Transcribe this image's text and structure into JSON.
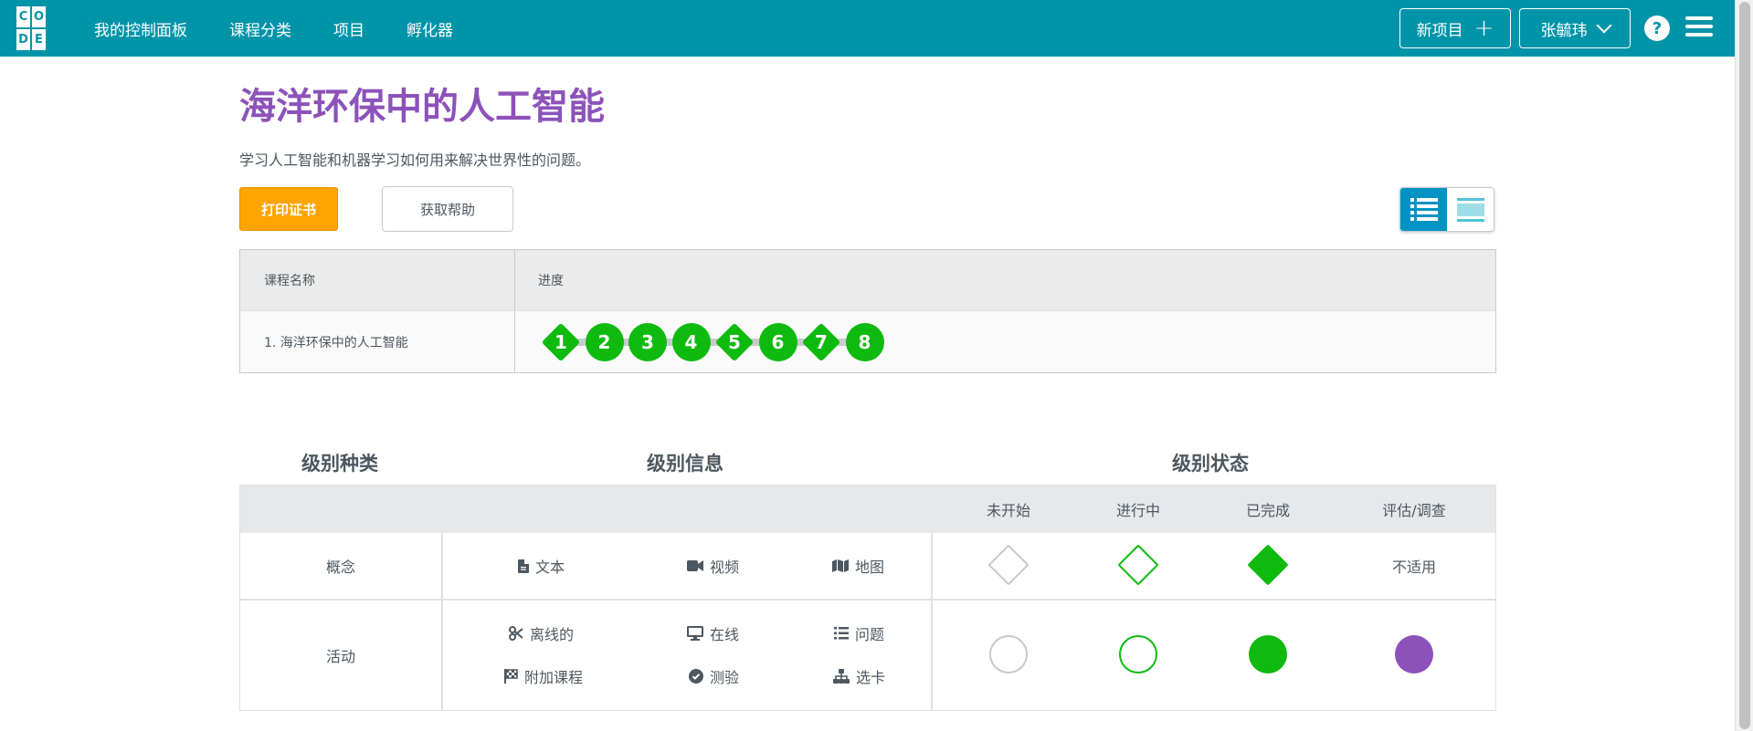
{
  "nav": {
    "logo_letters": [
      "C",
      "O",
      "",
      "D",
      "E",
      ""
    ],
    "items": [
      "我的控制面板",
      "课程分类",
      "项目",
      "孵化器"
    ],
    "new_project": "新项目",
    "user_name": "张毓玮",
    "help": "?"
  },
  "course": {
    "title": "海洋环保中的人工智能",
    "description": "学习人工智能和机器学习如何用来解决世界性的问题。",
    "print_button": "打印证书",
    "help_button": "获取帮助"
  },
  "progress_table": {
    "col_lesson": "课程名称",
    "col_progress": "进度",
    "rows": [
      {
        "lesson": "1. 海洋环保中的人工智能",
        "levels": [
          {
            "n": "1",
            "shape": "diamond",
            "status": "completed"
          },
          {
            "n": "2",
            "shape": "circle",
            "status": "completed"
          },
          {
            "n": "3",
            "shape": "circle",
            "status": "completed"
          },
          {
            "n": "4",
            "shape": "circle",
            "status": "completed"
          },
          {
            "n": "5",
            "shape": "diamond",
            "status": "completed"
          },
          {
            "n": "6",
            "shape": "circle",
            "status": "completed"
          },
          {
            "n": "7",
            "shape": "diamond",
            "status": "completed"
          },
          {
            "n": "8",
            "shape": "circle",
            "status": "completed"
          }
        ]
      }
    ]
  },
  "key": {
    "type_heading": "级别种类",
    "info_heading": "级别信息",
    "status_heading": "级别状态",
    "status_cols": [
      "未开始",
      "进行中",
      "已完成",
      "评估/调查"
    ],
    "concept": {
      "label": "概念",
      "items": [
        {
          "icon": "document-icon",
          "label": "文本"
        },
        {
          "icon": "video-icon",
          "label": "视频"
        },
        {
          "icon": "map-icon",
          "label": "地图"
        }
      ],
      "assessment": "不适用"
    },
    "activity": {
      "label": "活动",
      "items": [
        {
          "icon": "scissors-icon",
          "label": "离线的"
        },
        {
          "icon": "desktop-icon",
          "label": "在线"
        },
        {
          "icon": "list-icon",
          "label": "问题"
        },
        {
          "icon": "flag-icon",
          "label": "附加课程"
        },
        {
          "icon": "check-circle-icon",
          "label": "测验"
        },
        {
          "icon": "sitemap-icon",
          "label": "选卡"
        }
      ]
    }
  },
  "colors": {
    "header": "#0094a8",
    "title": "#8c52ba",
    "completed": "#0eba0e",
    "print_button": "#ffa400",
    "assessment": "#8c52ba"
  }
}
